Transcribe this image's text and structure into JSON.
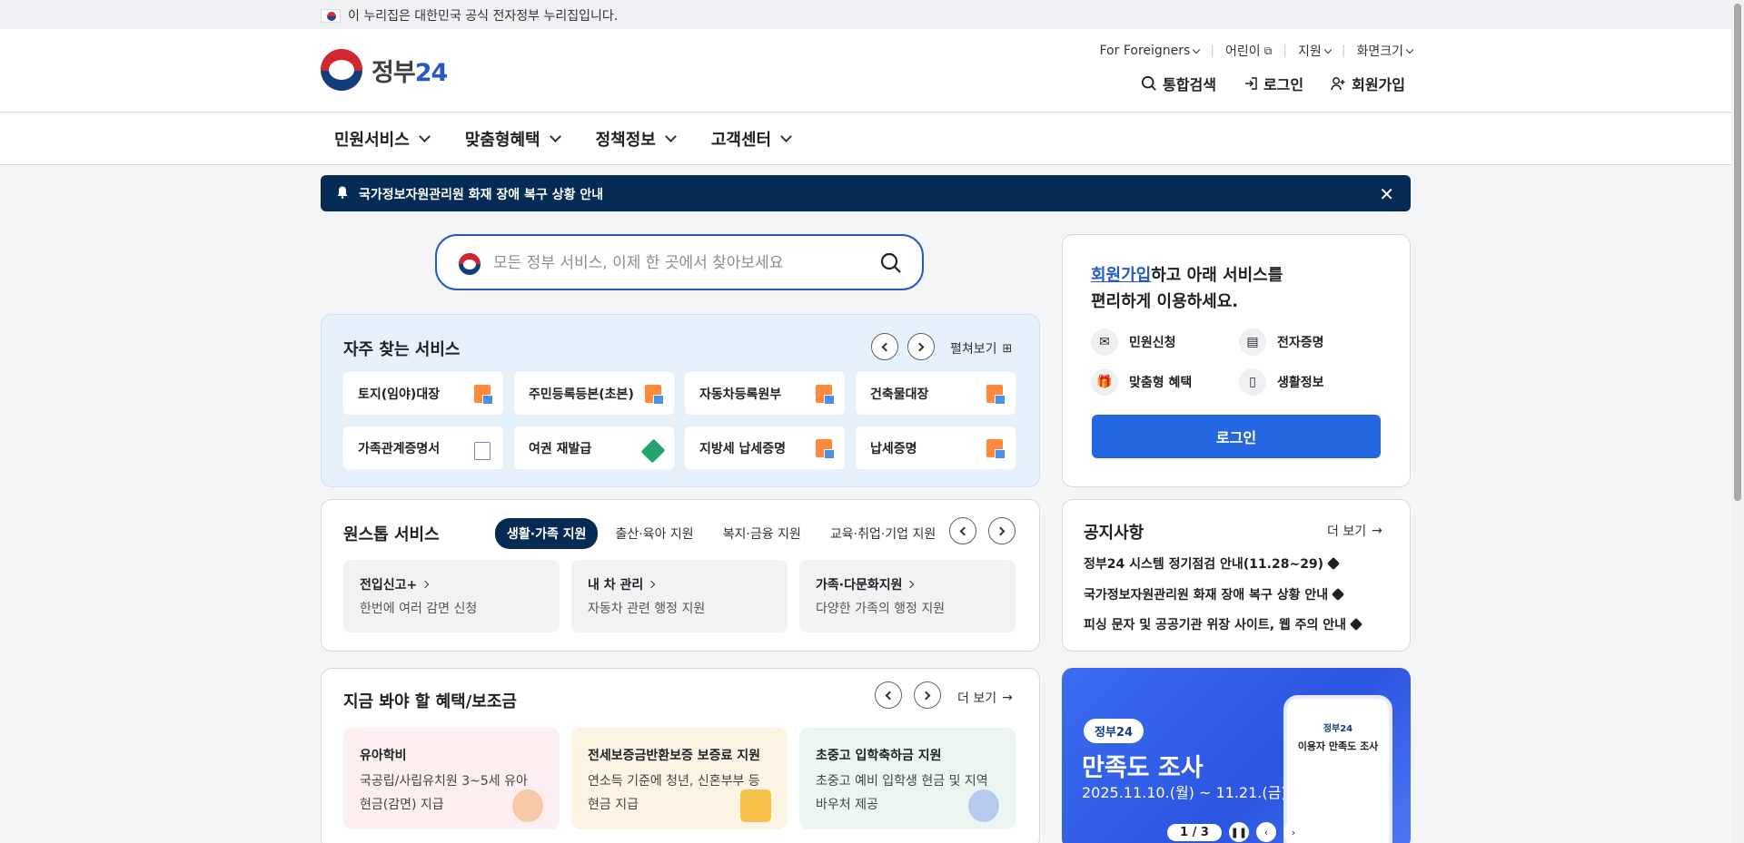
{
  "gov_bar": {
    "text": "이 누리집은 대한민국 공식 전자정부 누리집입니다."
  },
  "logo": {
    "text_main": "정부",
    "text_num": "24"
  },
  "util_menu": [
    {
      "label": "For Foreigners"
    },
    {
      "label": "어린이"
    },
    {
      "label": "지원"
    },
    {
      "label": "화면크기"
    }
  ],
  "actions": {
    "search": "통합검색",
    "login": "로그인",
    "signup": "회원가입"
  },
  "nav": [
    {
      "label": "민원서비스"
    },
    {
      "label": "맞춤형혜택"
    },
    {
      "label": "정책정보"
    },
    {
      "label": "고객센터"
    }
  ],
  "alert": {
    "text": "국가정보자원관리원 화재 장애 복구 상황 안내"
  },
  "search": {
    "placeholder": "모든 정부 서비스, 이제 한 곳에서 찾아보세요"
  },
  "frequent": {
    "title": "자주 찾는 서비스",
    "expand": "펼쳐보기",
    "items": [
      {
        "label": "토지(임야)대장",
        "icon": "document-icon"
      },
      {
        "label": "주민등록등본(초본)",
        "icon": "document-icon"
      },
      {
        "label": "자동차등록원부",
        "icon": "document-icon"
      },
      {
        "label": "건축물대장",
        "icon": "document-icon"
      },
      {
        "label": "가족관계증명서",
        "icon": "external-link-icon"
      },
      {
        "label": "여권 재발급",
        "icon": "pen-icon"
      },
      {
        "label": "지방세 납세증명",
        "icon": "document-icon"
      },
      {
        "label": "납세증명",
        "icon": "document-icon"
      }
    ]
  },
  "onestop": {
    "title": "원스톱 서비스",
    "tabs": [
      {
        "label": "생활·가족 지원"
      },
      {
        "label": "출산·육아 지원"
      },
      {
        "label": "복지·금융 지원"
      },
      {
        "label": "교육·취업·기업 지원"
      }
    ],
    "items": [
      {
        "title": "전입신고+",
        "desc": "한번에 여러 감면 신청"
      },
      {
        "title": "내 차 관리",
        "desc": "자동차 관련 행정 지원"
      },
      {
        "title": "가족·다문화지원",
        "desc": "다양한 가족의 행정 지원"
      }
    ]
  },
  "benefits": {
    "title": "지금 봐야 할 혜택/보조금",
    "more": "더 보기",
    "items": [
      {
        "title": "유아학비",
        "desc": "국공립/사립유치원 3~5세 유아 현금(감면) 지급",
        "bg": "#fdeff0"
      },
      {
        "title": "전세보증금반환보증 보증료 지원",
        "desc": "연소득 기준에 청년, 신혼부부 등 현금 지급",
        "bg": "#fdf3e3"
      },
      {
        "title": "초중고 입학축하금 지원",
        "desc": "초중고 예비 입학생 현금 및 지역 바우처 제공",
        "bg": "#eaf6ef"
      }
    ]
  },
  "login_card": {
    "link": "회원가입",
    "line1_rest": "하고 아래 서비스를",
    "line2": "편리하게 이용하세요.",
    "features": [
      {
        "label": "민원신청"
      },
      {
        "label": "전자증명"
      },
      {
        "label": "맞춤형 혜택"
      },
      {
        "label": "생활정보"
      }
    ],
    "button": "로그인"
  },
  "notice": {
    "title": "공지사항",
    "more": "더 보기",
    "items": [
      {
        "text": "정부24 시스템 정기점검 안내(11.28~29)"
      },
      {
        "text": "국가정보자원관리원 화재 장애 복구 상황 안내"
      },
      {
        "text": "피싱 문자 및 공공기관 위장 사이트, 웹 주의 안내"
      }
    ]
  },
  "banner": {
    "brand": "정부24",
    "title": "만족도 조사",
    "date": "2025.11.10.(월) ~ 11.21.(금)",
    "phone_title": "이용자 만족도 조사",
    "phone_brand": "정부24",
    "pager": "1 / 3"
  }
}
